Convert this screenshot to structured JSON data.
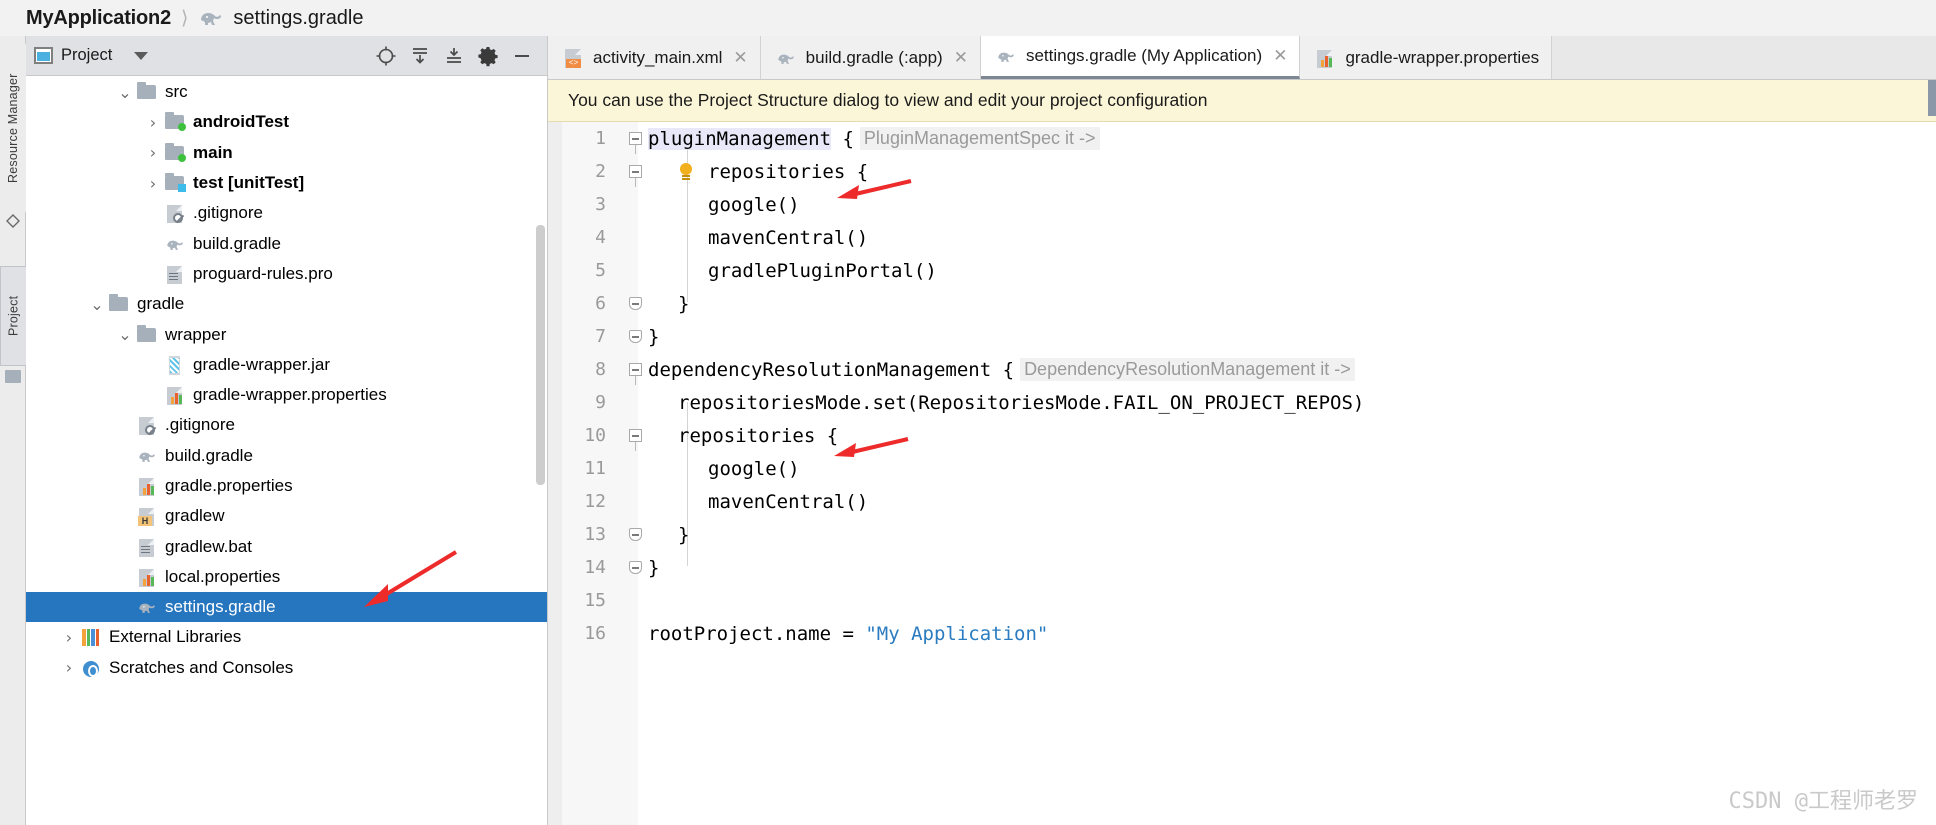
{
  "breadcrumb": {
    "project": "MyApplication2",
    "separator": "⟩",
    "file": "settings.gradle",
    "file_icon": "gradle-elephant-icon"
  },
  "left_strip": {
    "items": [
      {
        "label": "Resource Manager",
        "icon": "resource-manager-icon"
      },
      {
        "label": "Project",
        "icon": "project-folder-icon"
      }
    ]
  },
  "project_panel": {
    "title": "Project",
    "title_icon": "project-view-icon",
    "dropdown_icon": "chevron-down-icon",
    "toolbar": [
      {
        "name": "locate-icon",
        "glyph": "⊕"
      },
      {
        "name": "expand-all-icon",
        "glyph": "⤓"
      },
      {
        "name": "collapse-all-icon",
        "glyph": "⤒"
      },
      {
        "name": "settings-gear-icon",
        "glyph": "⚙"
      },
      {
        "name": "hide-panel-icon",
        "glyph": "−"
      }
    ],
    "tree": [
      {
        "label": "src",
        "indent": 3,
        "arrow": "down",
        "icon": "folder-icon",
        "bold": false,
        "selected": false
      },
      {
        "label": "androidTest",
        "indent": 4,
        "arrow": "right",
        "icon": "folder-green-icon",
        "bold": true,
        "selected": false
      },
      {
        "label": "main",
        "indent": 4,
        "arrow": "right",
        "icon": "folder-green-icon",
        "bold": true,
        "selected": false
      },
      {
        "label": "test [unitTest]",
        "indent": 4,
        "arrow": "right",
        "icon": "folder-blue-icon",
        "bold": true,
        "selected": false
      },
      {
        "label": ".gitignore",
        "indent": 4,
        "arrow": "none",
        "icon": "gitignore-icon",
        "bold": false,
        "selected": false
      },
      {
        "label": "build.gradle",
        "indent": 4,
        "arrow": "none",
        "icon": "gradle-elephant-icon",
        "bold": false,
        "selected": false
      },
      {
        "label": "proguard-rules.pro",
        "indent": 4,
        "arrow": "none",
        "icon": "text-file-icon",
        "bold": false,
        "selected": false
      },
      {
        "label": "gradle",
        "indent": 2,
        "arrow": "down",
        "icon": "folder-icon",
        "bold": false,
        "selected": false
      },
      {
        "label": "wrapper",
        "indent": 3,
        "arrow": "down",
        "icon": "folder-icon",
        "bold": false,
        "selected": false
      },
      {
        "label": "gradle-wrapper.jar",
        "indent": 4,
        "arrow": "none",
        "icon": "jar-icon",
        "bold": false,
        "selected": false
      },
      {
        "label": "gradle-wrapper.properties",
        "indent": 4,
        "arrow": "none",
        "icon": "properties-icon",
        "bold": false,
        "selected": false
      },
      {
        "label": ".gitignore",
        "indent": 3,
        "arrow": "none",
        "icon": "gitignore-icon",
        "bold": false,
        "selected": false
      },
      {
        "label": "build.gradle",
        "indent": 3,
        "arrow": "none",
        "icon": "gradle-elephant-icon",
        "bold": false,
        "selected": false
      },
      {
        "label": "gradle.properties",
        "indent": 3,
        "arrow": "none",
        "icon": "properties-icon",
        "bold": false,
        "selected": false
      },
      {
        "label": "gradlew",
        "indent": 3,
        "arrow": "none",
        "icon": "gradlew-icon",
        "bold": false,
        "selected": false
      },
      {
        "label": "gradlew.bat",
        "indent": 3,
        "arrow": "none",
        "icon": "text-file-icon",
        "bold": false,
        "selected": false
      },
      {
        "label": "local.properties",
        "indent": 3,
        "arrow": "none",
        "icon": "properties-icon",
        "bold": false,
        "selected": false
      },
      {
        "label": "settings.gradle",
        "indent": 3,
        "arrow": "none",
        "icon": "gradle-elephant-icon",
        "bold": false,
        "selected": true
      },
      {
        "label": "External Libraries",
        "indent": 1,
        "arrow": "right",
        "icon": "libraries-icon",
        "bold": false,
        "selected": false
      },
      {
        "label": "Scratches and Consoles",
        "indent": 1,
        "arrow": "right",
        "icon": "scratches-icon",
        "bold": false,
        "selected": false
      }
    ]
  },
  "editor": {
    "tabs": [
      {
        "label": "activity_main.xml",
        "icon": "xml-layout-icon",
        "active": false,
        "closable": true
      },
      {
        "label": "build.gradle (:app)",
        "icon": "gradle-elephant-icon",
        "active": false,
        "closable": true
      },
      {
        "label": "settings.gradle (My Application)",
        "icon": "gradle-elephant-icon",
        "active": true,
        "closable": true
      },
      {
        "label": "gradle-wrapper.properties",
        "icon": "properties-icon",
        "active": false,
        "closable": false
      }
    ],
    "notification": "You can use the Project Structure dialog to view and edit your project configuration",
    "lines": [
      {
        "num": "1",
        "fold": "start",
        "bulb": false,
        "indent": 0,
        "text": "pluginManagement",
        "kw": true,
        "brace": " {",
        "hint": "PluginManagementSpec it ->"
      },
      {
        "num": "2",
        "fold": "start",
        "bulb": true,
        "indent": 1,
        "text": "repositories {",
        "kw": false,
        "brace": "",
        "hint": ""
      },
      {
        "num": "3",
        "fold": "none",
        "bulb": false,
        "indent": 2,
        "text": "google()",
        "kw": false,
        "brace": "",
        "hint": ""
      },
      {
        "num": "4",
        "fold": "none",
        "bulb": false,
        "indent": 2,
        "text": "mavenCentral()",
        "kw": false,
        "brace": "",
        "hint": ""
      },
      {
        "num": "5",
        "fold": "none",
        "bulb": false,
        "indent": 2,
        "text": "gradlePluginPortal()",
        "kw": false,
        "brace": "",
        "hint": ""
      },
      {
        "num": "6",
        "fold": "end",
        "bulb": false,
        "indent": 1,
        "text": "}",
        "kw": false,
        "brace": "",
        "hint": ""
      },
      {
        "num": "7",
        "fold": "end",
        "bulb": false,
        "indent": 0,
        "text": "}",
        "kw": false,
        "brace": "",
        "hint": ""
      },
      {
        "num": "8",
        "fold": "start",
        "bulb": false,
        "indent": 0,
        "text": "dependencyResolutionManagement",
        "kw": false,
        "brace": " {",
        "hint": "DependencyResolutionManagement it ->"
      },
      {
        "num": "9",
        "fold": "none",
        "bulb": false,
        "indent": 1,
        "text": "repositoriesMode.set(RepositoriesMode.FAIL_ON_PROJECT_REPOS)",
        "kw": false,
        "brace": "",
        "hint": ""
      },
      {
        "num": "10",
        "fold": "start",
        "bulb": false,
        "indent": 1,
        "text": "repositories {",
        "kw": false,
        "brace": "",
        "hint": ""
      },
      {
        "num": "11",
        "fold": "none",
        "bulb": false,
        "indent": 2,
        "text": "google()",
        "kw": false,
        "brace": "",
        "hint": ""
      },
      {
        "num": "12",
        "fold": "none",
        "bulb": false,
        "indent": 2,
        "text": "mavenCentral()",
        "kw": false,
        "brace": "",
        "hint": ""
      },
      {
        "num": "13",
        "fold": "end",
        "bulb": false,
        "indent": 1,
        "text": "}",
        "kw": false,
        "brace": "",
        "hint": ""
      },
      {
        "num": "14",
        "fold": "end",
        "bulb": false,
        "indent": 0,
        "text": "}",
        "kw": false,
        "brace": "",
        "hint": ""
      },
      {
        "num": "15",
        "fold": "none",
        "bulb": false,
        "indent": 0,
        "text": "",
        "kw": false,
        "brace": "",
        "hint": ""
      },
      {
        "num": "16",
        "fold": "none",
        "bulb": false,
        "indent": 0,
        "text": "rootProject.name = ",
        "kw": false,
        "brace": "",
        "hint": "",
        "string": "\"My Application\""
      }
    ]
  },
  "annotations": {
    "arrow_color": "#ee2b2b",
    "arrows": [
      {
        "name": "arrow-pointing-google-line3"
      },
      {
        "name": "arrow-pointing-google-line11"
      },
      {
        "name": "arrow-pointing-settings-gradle-file"
      }
    ]
  },
  "watermark": "CSDN @工程师老罗",
  "colors": {
    "selection_blue": "#2675bf",
    "notification_yellow": "#fcf6d8",
    "accent_orange": "#e8622d"
  }
}
